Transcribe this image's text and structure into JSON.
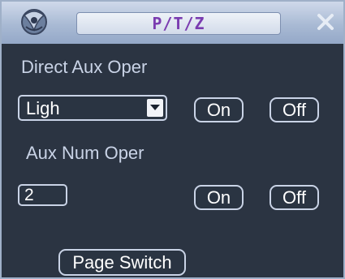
{
  "window": {
    "title": "P/T/Z"
  },
  "direct_aux": {
    "heading": "Direct Aux Oper",
    "select_value": "Ligh",
    "on_label": "On",
    "off_label": "Off"
  },
  "aux_num": {
    "heading": "Aux Num Oper",
    "number_value": "2",
    "on_label": "On",
    "off_label": "Off"
  },
  "footer": {
    "page_switch_label": "Page Switch"
  },
  "colors": {
    "background": "#2b3442",
    "text": "#c9d3e6",
    "title_text": "#7a3cb0"
  },
  "icons": {
    "logo": "logo-icon",
    "close": "close-icon",
    "dropdown": "chevron-down-icon"
  }
}
